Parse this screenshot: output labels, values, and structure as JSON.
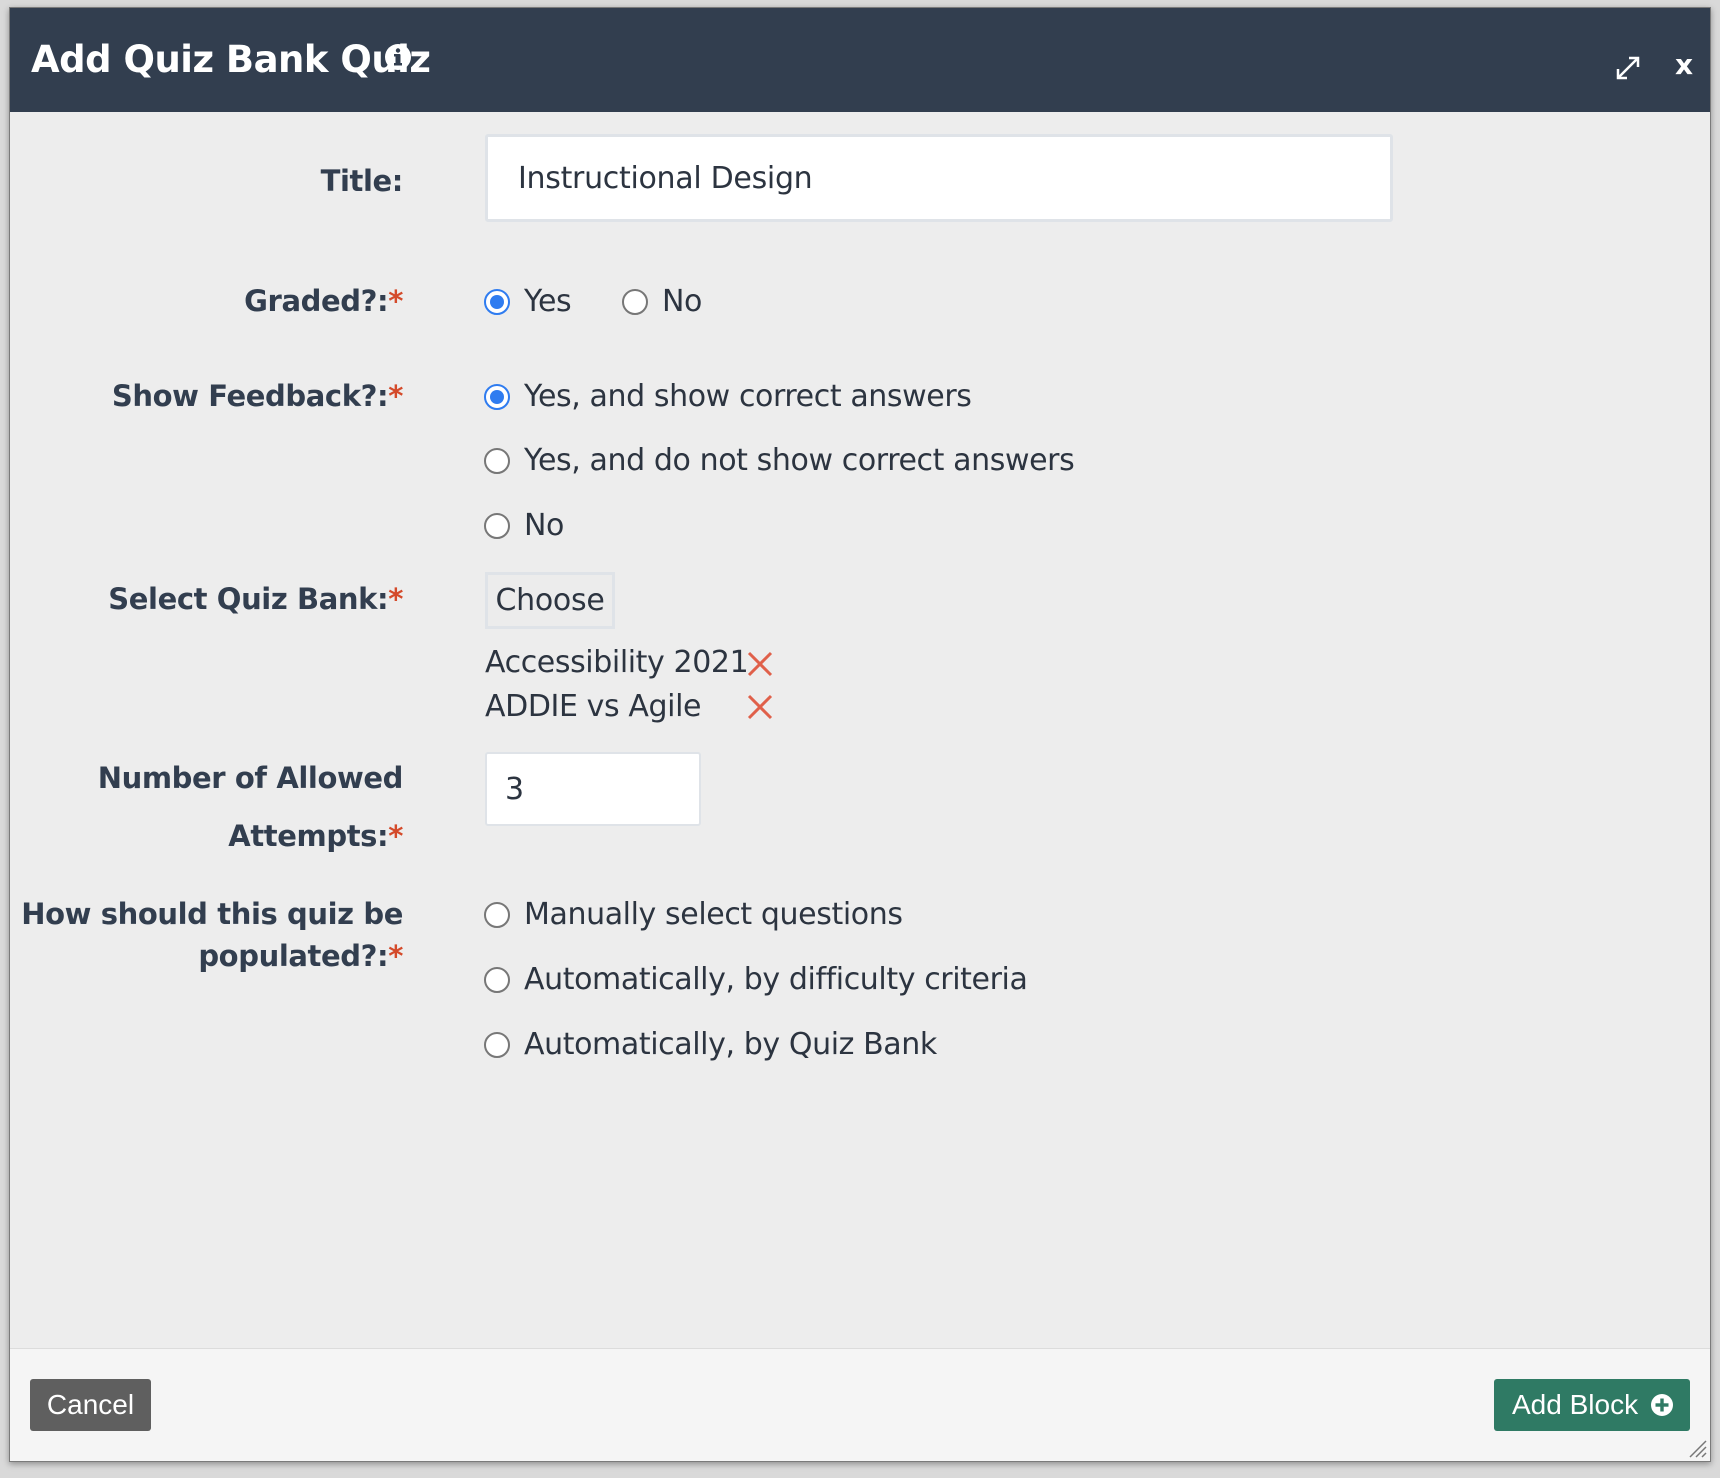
{
  "dialog": {
    "title": "Add Quiz Bank Quiz",
    "info_icon": "info-icon",
    "expand_icon": "expand-icon",
    "close_label": "x"
  },
  "form": {
    "title_label": "Title:",
    "title_value": "Instructional Design",
    "graded_label": "Graded?:",
    "graded_options": [
      "Yes",
      "No"
    ],
    "graded_selected": "Yes",
    "feedback_label": "Show Feedback?:",
    "feedback_options": [
      "Yes, and show correct answers",
      "Yes, and do not show correct answers",
      "No"
    ],
    "feedback_selected": "Yes, and show correct answers",
    "quizbank_label": "Select Quiz Bank:",
    "choose_label": "Choose",
    "selected_banks": [
      "Accessibility 2021",
      "ADDIE vs Agile"
    ],
    "attempts_label_line1": "Number of Allowed",
    "attempts_label_line2": "Attempts:",
    "attempts_value": "3",
    "populate_label_line1": "How should this quiz be",
    "populate_label_line2": "populated?:",
    "populate_options": [
      "Manually select questions",
      "Automatically, by difficulty criteria",
      "Automatically, by Quiz Bank"
    ],
    "required_marker": "*"
  },
  "footer": {
    "cancel_label": "Cancel",
    "add_label": "Add Block"
  },
  "colors": {
    "titlebar": "#323e4f",
    "accent_radio": "#2f7cf0",
    "required": "#d44a2a",
    "remove_x": "#e0604a",
    "add_button": "#2f7a64",
    "cancel_button": "#5f5f5f"
  }
}
